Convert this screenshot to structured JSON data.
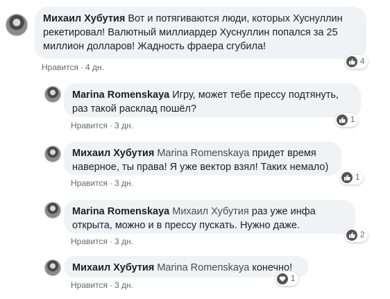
{
  "comments": [
    {
      "author": "Михаил Хубутия",
      "mention": "",
      "text": "Вот и потягиваются люди, которых Хуснуллин рекетировал! Валютный миллиардер Хуснуллин попался за 25 миллион долларов! Жадность фраера сгубила!",
      "like_label": "Нравится",
      "time": "4 дн.",
      "reaction_count": "4",
      "reaction_icon": "thumbs-up-icon"
    },
    {
      "author": "Marina Romenskaya",
      "mention": "",
      "text": "Игру, может тебе прессу подтянуть, раз такой расклад пошёл?",
      "like_label": "Нравится",
      "time": "3 дн.",
      "reaction_count": "1",
      "reaction_icon": "thumbs-up-icon"
    },
    {
      "author": "Михаил Хубутия",
      "mention": "Marina Romenskaya",
      "text": "придет время наверное, ты права! Я уже вектор взял! Таких немало)",
      "like_label": "Нравится",
      "time": "3 дн.",
      "reaction_count": "1",
      "reaction_icon": "thumbs-up-icon"
    },
    {
      "author": "Marina Romenskaya",
      "mention": "Михаил Хубутия",
      "text": "раз уже инфа открыта, можно и в прессу пускать. Нужно даже.",
      "like_label": "Нравится",
      "time": "3 дн.",
      "reaction_count": "2",
      "reaction_icon": "thumbs-up-icon"
    },
    {
      "author": "Михаил Хубутия",
      "mention": "Marina Romenskaya",
      "text": "конечно!",
      "like_label": "Нравится",
      "time": "3 дн.",
      "reaction_count": "1",
      "reaction_icon": "heart-icon"
    }
  ]
}
